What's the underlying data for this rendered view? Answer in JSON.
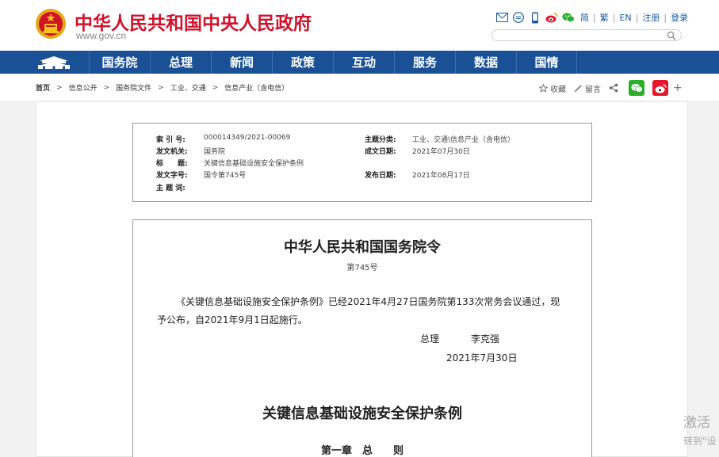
{
  "header": {
    "site_title": "中华人民共和国中央人民政府",
    "site_url": "www.gov.cn",
    "lang_links": [
      "简",
      "繁",
      "EN"
    ],
    "register": "注册",
    "login": "登录",
    "colors": {
      "brand_red": "#d0122b",
      "nav_blue": "#1a5196"
    }
  },
  "nav": {
    "items": [
      "国务院",
      "总理",
      "新闻",
      "政策",
      "互动",
      "服务",
      "数据",
      "国情"
    ]
  },
  "breadcrumb": {
    "items": [
      "首页",
      "信息公开",
      "国务院文件",
      "工业、交通",
      "信息产业（含电信）"
    ],
    "separator": ">"
  },
  "tools": {
    "favorite": "收藏",
    "comment": "留言"
  },
  "meta": {
    "index_label": "索 引 号:",
    "index_value": "000014349/2021-00069",
    "topic_label": "主题分类:",
    "topic_value": "工业、交通\\信息产业（含电信）",
    "issuer_label": "发文机关:",
    "issuer_value": "国务院",
    "created_label": "成文日期:",
    "created_value": "2021年07月30日",
    "title_label": "标　　题:",
    "title_value": "关键信息基础设施安全保护条例",
    "docno_label": "发文字号:",
    "docno_value": "国令第745号",
    "published_label": "发布日期:",
    "published_value": "2021年08月17日",
    "keywords_label": "主 题 词:",
    "keywords_value": ""
  },
  "document": {
    "order_title": "中华人民共和国国务院令",
    "order_no": "第745号",
    "paragraph": "《关键信息基础设施安全保护条例》已经2021年4月27日国务院第133次常务会议通过，现予公布，自2021年9月1日起施行。",
    "sign_role": "总理",
    "sign_name": "李克强",
    "sign_date": "2021年7月30日",
    "regulation_title": "关键信息基础设施安全保护条例",
    "chapter": "第一章　总　　则"
  },
  "watermark": {
    "line1": "激活",
    "line2": "转到\"设"
  }
}
